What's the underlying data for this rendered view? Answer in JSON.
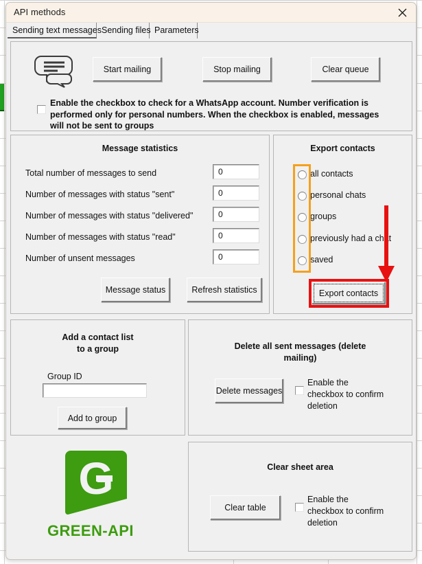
{
  "window": {
    "title": "API methods",
    "close_icon": "close-icon"
  },
  "tabs": [
    {
      "label": "Sending text messages",
      "active": true
    },
    {
      "label": "Sending files",
      "active": false
    },
    {
      "label": "Parameters",
      "active": false
    }
  ],
  "toolbar": {
    "icon": "speech-bubbles-icon",
    "buttons": [
      {
        "label": "Start mailing"
      },
      {
        "label": "Stop mailing"
      },
      {
        "label": "Clear queue"
      }
    ],
    "checkbox": {
      "checked": false,
      "label_line1": "Enable the checkbox to check for a WhatsApp account. Number verification is",
      "label_line2": "performed only for personal numbers. When the checkbox is enabled, messages",
      "label_line3": "will not be sent to groups"
    }
  },
  "message_statistics": {
    "title": "Message statistics",
    "rows": [
      {
        "label": "Total number of messages to send",
        "value": "0"
      },
      {
        "label": "Number of messages with status \"sent\"",
        "value": "0"
      },
      {
        "label": "Number of messages with status \"delivered\"",
        "value": "0"
      },
      {
        "label": "Number of messages with status \"read\"",
        "value": "0"
      },
      {
        "label": "Number of unsent messages",
        "value": "0"
      }
    ],
    "buttons": [
      {
        "label": "Message status"
      },
      {
        "label": "Refresh statistics"
      }
    ]
  },
  "export_contacts": {
    "title": "Export contacts",
    "options": [
      {
        "label": "all contacts",
        "selected": false
      },
      {
        "label": "personal chats",
        "selected": false
      },
      {
        "label": "groups",
        "selected": false
      },
      {
        "label": "previously had a chat",
        "selected": false
      },
      {
        "label": "saved",
        "selected": false
      }
    ],
    "button_label": "Export contacts",
    "highlight_options_color": "#f5a01e",
    "highlight_button_color": "#e81111",
    "arrow_color": "#e81111"
  },
  "add_to_group": {
    "title_line1": "Add a contact list",
    "title_line2": "to a group",
    "field_label": "Group ID",
    "field_value": "",
    "field_placeholder": "",
    "button_label": "Add to group"
  },
  "delete_messages": {
    "title_line1": "Delete all sent messages (delete",
    "title_line2": "mailing)",
    "button_label": "Delete messages",
    "checkbox": {
      "checked": false,
      "label_line1": "Enable the",
      "label_line2": "checkbox to confirm",
      "label_line3": "deletion"
    }
  },
  "clear_sheet": {
    "title": "Clear sheet area",
    "button_label": "Clear table",
    "checkbox": {
      "checked": false,
      "label_line1": "Enable the",
      "label_line2": "checkbox to confirm",
      "label_line3": "deletion"
    }
  },
  "branding": {
    "logo_icon": "green-api-logo",
    "logo_letter": "G",
    "name": "GREEN-API",
    "color": "#3d9c0f"
  }
}
